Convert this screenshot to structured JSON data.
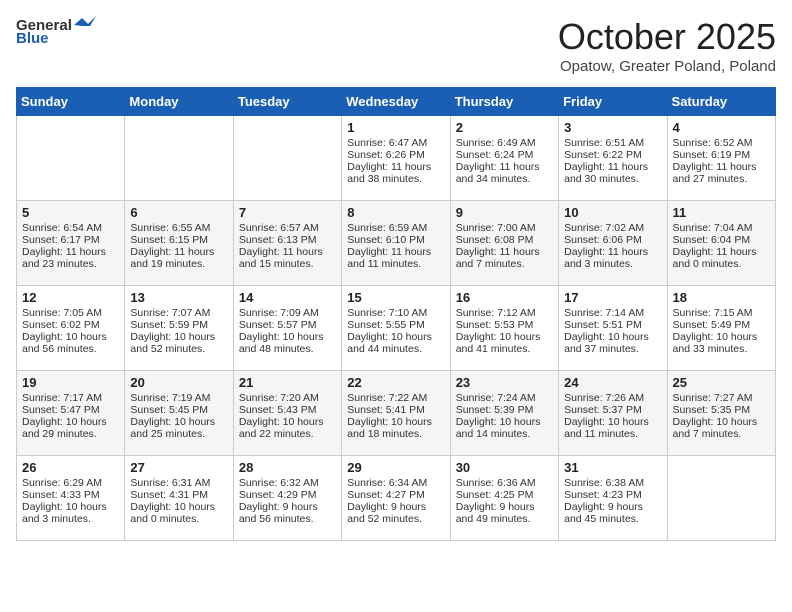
{
  "header": {
    "logo_general": "General",
    "logo_blue": "Blue",
    "month": "October 2025",
    "location": "Opatow, Greater Poland, Poland"
  },
  "days_of_week": [
    "Sunday",
    "Monday",
    "Tuesday",
    "Wednesday",
    "Thursday",
    "Friday",
    "Saturday"
  ],
  "weeks": [
    [
      {
        "day": "",
        "content": ""
      },
      {
        "day": "",
        "content": ""
      },
      {
        "day": "",
        "content": ""
      },
      {
        "day": "1",
        "content": "Sunrise: 6:47 AM\nSunset: 6:26 PM\nDaylight: 11 hours\nand 38 minutes."
      },
      {
        "day": "2",
        "content": "Sunrise: 6:49 AM\nSunset: 6:24 PM\nDaylight: 11 hours\nand 34 minutes."
      },
      {
        "day": "3",
        "content": "Sunrise: 6:51 AM\nSunset: 6:22 PM\nDaylight: 11 hours\nand 30 minutes."
      },
      {
        "day": "4",
        "content": "Sunrise: 6:52 AM\nSunset: 6:19 PM\nDaylight: 11 hours\nand 27 minutes."
      }
    ],
    [
      {
        "day": "5",
        "content": "Sunrise: 6:54 AM\nSunset: 6:17 PM\nDaylight: 11 hours\nand 23 minutes."
      },
      {
        "day": "6",
        "content": "Sunrise: 6:55 AM\nSunset: 6:15 PM\nDaylight: 11 hours\nand 19 minutes."
      },
      {
        "day": "7",
        "content": "Sunrise: 6:57 AM\nSunset: 6:13 PM\nDaylight: 11 hours\nand 15 minutes."
      },
      {
        "day": "8",
        "content": "Sunrise: 6:59 AM\nSunset: 6:10 PM\nDaylight: 11 hours\nand 11 minutes."
      },
      {
        "day": "9",
        "content": "Sunrise: 7:00 AM\nSunset: 6:08 PM\nDaylight: 11 hours\nand 7 minutes."
      },
      {
        "day": "10",
        "content": "Sunrise: 7:02 AM\nSunset: 6:06 PM\nDaylight: 11 hours\nand 3 minutes."
      },
      {
        "day": "11",
        "content": "Sunrise: 7:04 AM\nSunset: 6:04 PM\nDaylight: 11 hours\nand 0 minutes."
      }
    ],
    [
      {
        "day": "12",
        "content": "Sunrise: 7:05 AM\nSunset: 6:02 PM\nDaylight: 10 hours\nand 56 minutes."
      },
      {
        "day": "13",
        "content": "Sunrise: 7:07 AM\nSunset: 5:59 PM\nDaylight: 10 hours\nand 52 minutes."
      },
      {
        "day": "14",
        "content": "Sunrise: 7:09 AM\nSunset: 5:57 PM\nDaylight: 10 hours\nand 48 minutes."
      },
      {
        "day": "15",
        "content": "Sunrise: 7:10 AM\nSunset: 5:55 PM\nDaylight: 10 hours\nand 44 minutes."
      },
      {
        "day": "16",
        "content": "Sunrise: 7:12 AM\nSunset: 5:53 PM\nDaylight: 10 hours\nand 41 minutes."
      },
      {
        "day": "17",
        "content": "Sunrise: 7:14 AM\nSunset: 5:51 PM\nDaylight: 10 hours\nand 37 minutes."
      },
      {
        "day": "18",
        "content": "Sunrise: 7:15 AM\nSunset: 5:49 PM\nDaylight: 10 hours\nand 33 minutes."
      }
    ],
    [
      {
        "day": "19",
        "content": "Sunrise: 7:17 AM\nSunset: 5:47 PM\nDaylight: 10 hours\nand 29 minutes."
      },
      {
        "day": "20",
        "content": "Sunrise: 7:19 AM\nSunset: 5:45 PM\nDaylight: 10 hours\nand 25 minutes."
      },
      {
        "day": "21",
        "content": "Sunrise: 7:20 AM\nSunset: 5:43 PM\nDaylight: 10 hours\nand 22 minutes."
      },
      {
        "day": "22",
        "content": "Sunrise: 7:22 AM\nSunset: 5:41 PM\nDaylight: 10 hours\nand 18 minutes."
      },
      {
        "day": "23",
        "content": "Sunrise: 7:24 AM\nSunset: 5:39 PM\nDaylight: 10 hours\nand 14 minutes."
      },
      {
        "day": "24",
        "content": "Sunrise: 7:26 AM\nSunset: 5:37 PM\nDaylight: 10 hours\nand 11 minutes."
      },
      {
        "day": "25",
        "content": "Sunrise: 7:27 AM\nSunset: 5:35 PM\nDaylight: 10 hours\nand 7 minutes."
      }
    ],
    [
      {
        "day": "26",
        "content": "Sunrise: 6:29 AM\nSunset: 4:33 PM\nDaylight: 10 hours\nand 3 minutes."
      },
      {
        "day": "27",
        "content": "Sunrise: 6:31 AM\nSunset: 4:31 PM\nDaylight: 10 hours\nand 0 minutes."
      },
      {
        "day": "28",
        "content": "Sunrise: 6:32 AM\nSunset: 4:29 PM\nDaylight: 9 hours\nand 56 minutes."
      },
      {
        "day": "29",
        "content": "Sunrise: 6:34 AM\nSunset: 4:27 PM\nDaylight: 9 hours\nand 52 minutes."
      },
      {
        "day": "30",
        "content": "Sunrise: 6:36 AM\nSunset: 4:25 PM\nDaylight: 9 hours\nand 49 minutes."
      },
      {
        "day": "31",
        "content": "Sunrise: 6:38 AM\nSunset: 4:23 PM\nDaylight: 9 hours\nand 45 minutes."
      },
      {
        "day": "",
        "content": ""
      }
    ]
  ]
}
